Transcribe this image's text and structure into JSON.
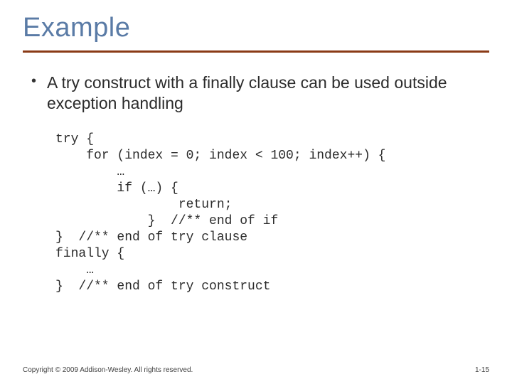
{
  "title": "Example",
  "bullet": "A try construct with a finally clause can be used outside exception handling",
  "code": "try {\n    for (index = 0; index < 100; index++) {\n        …\n        if (…) {\n                return;\n            }  //** end of if\n}  //** end of try clause\nfinally {\n    …\n}  //** end of try construct",
  "footer": {
    "copyright": "Copyright © 2009 Addison-Wesley. All rights reserved.",
    "page": "1-15"
  }
}
